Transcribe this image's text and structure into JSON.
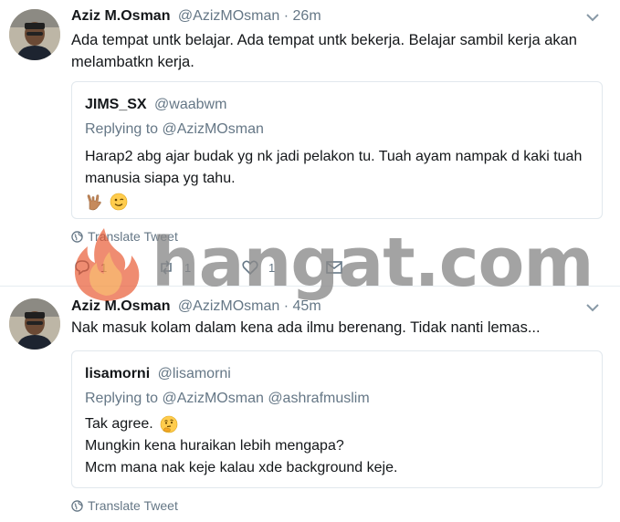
{
  "tweets": [
    {
      "name": "Aziz M.Osman",
      "handle": "@AzizMOsman",
      "separator": "·",
      "time": "26m",
      "text": "Ada tempat untk belajar. Ada tempat untk bekerja. Belajar sambil kerja akan melambatkn kerja.",
      "quote": {
        "name": "JIMS_SX",
        "handle": "@waabwm",
        "replying_prefix": "Replying to",
        "replying_to": "@AzizMOsman",
        "body_line1": "Harap2 abg ajar budak yg nk jadi pelakon tu. Tuah ayam nampak d kaki tuah manusia siapa yg tahu.",
        "emojis": [
          "rock-on-hand-emoji",
          "wink-face-emoji"
        ]
      },
      "translate_label": "Translate Tweet",
      "actions": {
        "reply_count": "1",
        "retweet_count": "1",
        "like_count": "1"
      }
    },
    {
      "name": "Aziz M.Osman",
      "handle": "@AzizMOsman",
      "separator": "·",
      "time": "45m",
      "text": "Nak masuk kolam dalam kena ada ilmu berenang. Tidak nanti lemas...",
      "quote": {
        "name": "lisamorni",
        "handle": "@lisamorni",
        "replying_prefix": "Replying to",
        "replying_to": "@AzizMOsman @ashrafmuslim",
        "line1": "Tak agree.",
        "line1_emoji": "thinking-face-emoji",
        "line2": "Mungkin kena huraikan lebih mengapa?",
        "line3": "Mcm mana nak keje kalau xde background keje."
      },
      "translate_label": "Translate Tweet"
    }
  ],
  "watermark": {
    "text": "hangat.com",
    "color": "#8a8a8a",
    "flame_color": "#e8522a"
  },
  "colors": {
    "text": "#14171a",
    "secondary": "#657786",
    "border": "#e1e8ed"
  }
}
